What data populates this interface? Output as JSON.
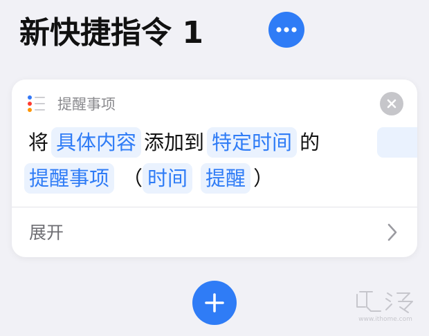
{
  "shortcut": {
    "title": "新快捷指令 1",
    "more_icon": "ellipsis-icon",
    "accent_color": "#2f7cf6"
  },
  "action_card": {
    "app_icon": "reminders-list-icon",
    "app_name": "提醒事项",
    "close_icon": "xmark-icon",
    "sentence_line1": {
      "word_1": "将",
      "token_1": "具体内容",
      "word_2": "添加到",
      "token_2": "特定时间",
      "word_3": "的"
    },
    "sentence_line2": {
      "token_3": "提醒事项",
      "paren_open": "（",
      "token_4": "时间",
      "token_5": "提醒",
      "paren_close": "）"
    },
    "expand_label": "展开",
    "expand_icon": "chevron-right-icon"
  },
  "add_action": {
    "icon": "plus-icon"
  },
  "watermark": {
    "url": "www.ithome.com"
  }
}
